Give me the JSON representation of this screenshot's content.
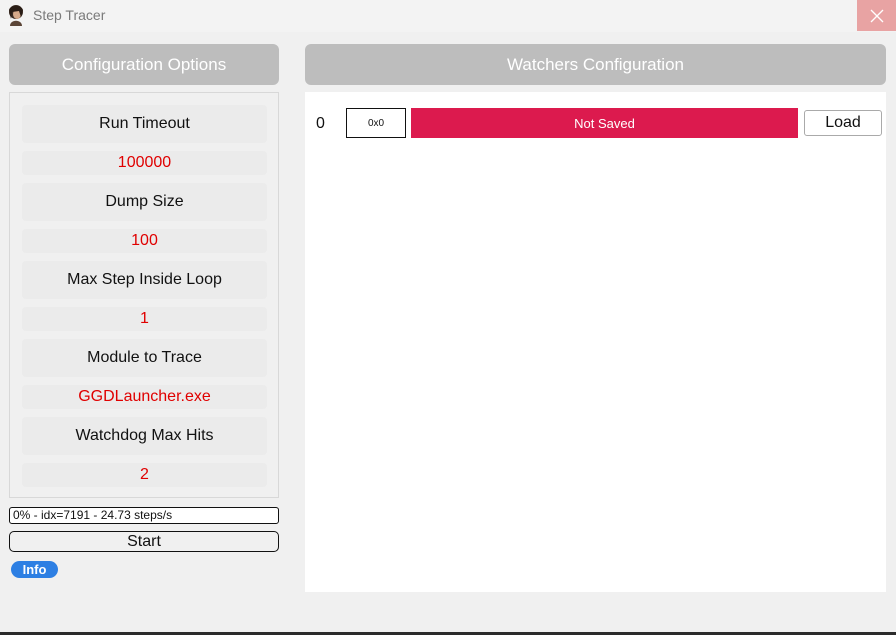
{
  "window": {
    "title": "Step Tracer"
  },
  "config": {
    "header": "Configuration Options",
    "items": [
      {
        "label": "Run Timeout",
        "value": "100000"
      },
      {
        "label": "Dump Size",
        "value": "100"
      },
      {
        "label": "Max Step Inside Loop",
        "value": "1"
      },
      {
        "label": "Module to Trace",
        "value": "GGDLauncher.exe"
      },
      {
        "label": "Watchdog Max Hits",
        "value": "2"
      }
    ],
    "progress_text": "0% - idx=7191 - 24.73 steps/s",
    "start_label": "Start",
    "info_label": "Info"
  },
  "watchers": {
    "header": "Watchers Configuration",
    "rows": [
      {
        "index": "0",
        "address": "0x0",
        "status": "Not Saved",
        "load_label": "Load"
      }
    ]
  },
  "colors": {
    "header_bg": "#bdbdbd",
    "value_text": "#e00000",
    "status_bg": "#dc1a4e",
    "info_bg": "#2d7fe3",
    "close_bg": "#e8a3a3"
  },
  "icons": {
    "app": "user-avatar-icon",
    "close": "close-icon"
  }
}
